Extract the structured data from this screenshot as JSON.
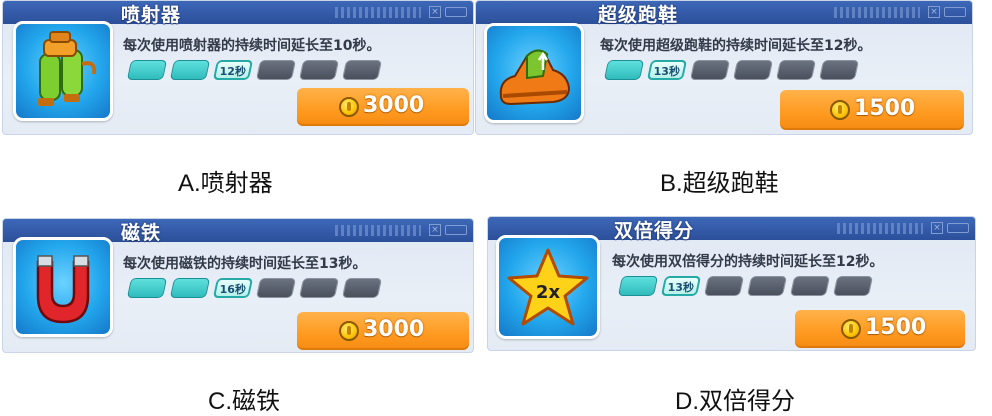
{
  "cards": [
    {
      "title": "喷射器",
      "description": "每次使用喷射器的持续时间延长至10秒。",
      "current_level_label": "12秒",
      "filled_levels": 2,
      "total_levels": 6,
      "price": "3000",
      "caption": "A.喷射器",
      "icon": "jetpack-icon"
    },
    {
      "title": "超级跑鞋",
      "description": "每次使用超级跑鞋的持续时间延长至12秒。",
      "current_level_label": "13秒",
      "filled_levels": 1,
      "total_levels": 6,
      "price": "1500",
      "caption": "B.超级跑鞋",
      "icon": "super-sneakers-icon"
    },
    {
      "title": "磁铁",
      "description": "每次使用磁铁的持续时间延长至13秒。",
      "current_level_label": "16秒",
      "filled_levels": 2,
      "total_levels": 6,
      "price": "3000",
      "caption": "C.磁铁",
      "icon": "magnet-icon"
    },
    {
      "title": "双倍得分",
      "description": "每次使用双倍得分的持续时间延长至12秒。",
      "current_level_label": "13秒",
      "filled_levels": 1,
      "total_levels": 6,
      "price": "1500",
      "caption": "D.双倍得分",
      "icon": "double-score-star-icon",
      "icon_text": "2x"
    }
  ],
  "colors": {
    "header": "#2c4f9a",
    "price_button": "#ff9a1f",
    "filled_segment": "#2fbcbc",
    "empty_segment": "#4a515d",
    "icon_background": "#22a6ec"
  }
}
